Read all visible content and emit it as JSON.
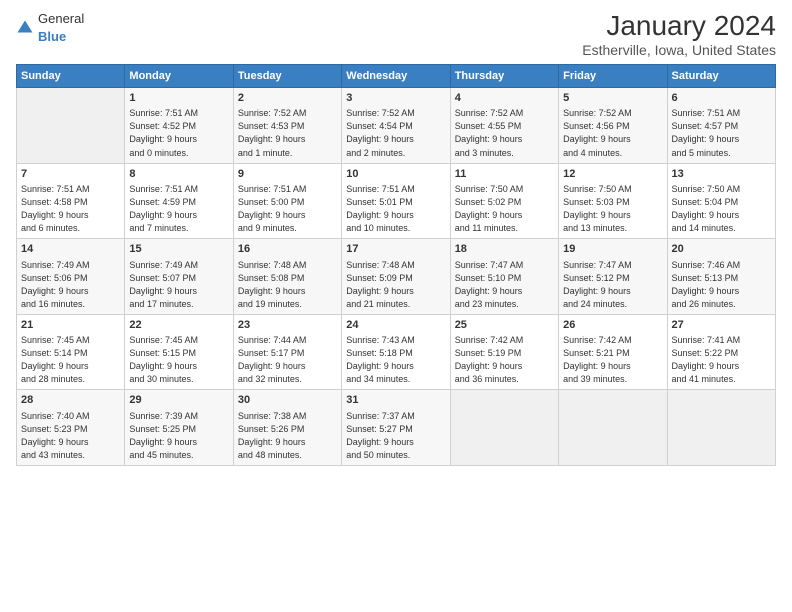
{
  "logo": {
    "general": "General",
    "blue": "Blue"
  },
  "title": "January 2024",
  "subtitle": "Estherville, Iowa, United States",
  "columns": [
    "Sunday",
    "Monday",
    "Tuesday",
    "Wednesday",
    "Thursday",
    "Friday",
    "Saturday"
  ],
  "weeks": [
    [
      {
        "day": "",
        "content": ""
      },
      {
        "day": "1",
        "content": "Sunrise: 7:51 AM\nSunset: 4:52 PM\nDaylight: 9 hours\nand 0 minutes."
      },
      {
        "day": "2",
        "content": "Sunrise: 7:52 AM\nSunset: 4:53 PM\nDaylight: 9 hours\nand 1 minute."
      },
      {
        "day": "3",
        "content": "Sunrise: 7:52 AM\nSunset: 4:54 PM\nDaylight: 9 hours\nand 2 minutes."
      },
      {
        "day": "4",
        "content": "Sunrise: 7:52 AM\nSunset: 4:55 PM\nDaylight: 9 hours\nand 3 minutes."
      },
      {
        "day": "5",
        "content": "Sunrise: 7:52 AM\nSunset: 4:56 PM\nDaylight: 9 hours\nand 4 minutes."
      },
      {
        "day": "6",
        "content": "Sunrise: 7:51 AM\nSunset: 4:57 PM\nDaylight: 9 hours\nand 5 minutes."
      }
    ],
    [
      {
        "day": "7",
        "content": "Sunrise: 7:51 AM\nSunset: 4:58 PM\nDaylight: 9 hours\nand 6 minutes."
      },
      {
        "day": "8",
        "content": "Sunrise: 7:51 AM\nSunset: 4:59 PM\nDaylight: 9 hours\nand 7 minutes."
      },
      {
        "day": "9",
        "content": "Sunrise: 7:51 AM\nSunset: 5:00 PM\nDaylight: 9 hours\nand 9 minutes."
      },
      {
        "day": "10",
        "content": "Sunrise: 7:51 AM\nSunset: 5:01 PM\nDaylight: 9 hours\nand 10 minutes."
      },
      {
        "day": "11",
        "content": "Sunrise: 7:50 AM\nSunset: 5:02 PM\nDaylight: 9 hours\nand 11 minutes."
      },
      {
        "day": "12",
        "content": "Sunrise: 7:50 AM\nSunset: 5:03 PM\nDaylight: 9 hours\nand 13 minutes."
      },
      {
        "day": "13",
        "content": "Sunrise: 7:50 AM\nSunset: 5:04 PM\nDaylight: 9 hours\nand 14 minutes."
      }
    ],
    [
      {
        "day": "14",
        "content": "Sunrise: 7:49 AM\nSunset: 5:06 PM\nDaylight: 9 hours\nand 16 minutes."
      },
      {
        "day": "15",
        "content": "Sunrise: 7:49 AM\nSunset: 5:07 PM\nDaylight: 9 hours\nand 17 minutes."
      },
      {
        "day": "16",
        "content": "Sunrise: 7:48 AM\nSunset: 5:08 PM\nDaylight: 9 hours\nand 19 minutes."
      },
      {
        "day": "17",
        "content": "Sunrise: 7:48 AM\nSunset: 5:09 PM\nDaylight: 9 hours\nand 21 minutes."
      },
      {
        "day": "18",
        "content": "Sunrise: 7:47 AM\nSunset: 5:10 PM\nDaylight: 9 hours\nand 23 minutes."
      },
      {
        "day": "19",
        "content": "Sunrise: 7:47 AM\nSunset: 5:12 PM\nDaylight: 9 hours\nand 24 minutes."
      },
      {
        "day": "20",
        "content": "Sunrise: 7:46 AM\nSunset: 5:13 PM\nDaylight: 9 hours\nand 26 minutes."
      }
    ],
    [
      {
        "day": "21",
        "content": "Sunrise: 7:45 AM\nSunset: 5:14 PM\nDaylight: 9 hours\nand 28 minutes."
      },
      {
        "day": "22",
        "content": "Sunrise: 7:45 AM\nSunset: 5:15 PM\nDaylight: 9 hours\nand 30 minutes."
      },
      {
        "day": "23",
        "content": "Sunrise: 7:44 AM\nSunset: 5:17 PM\nDaylight: 9 hours\nand 32 minutes."
      },
      {
        "day": "24",
        "content": "Sunrise: 7:43 AM\nSunset: 5:18 PM\nDaylight: 9 hours\nand 34 minutes."
      },
      {
        "day": "25",
        "content": "Sunrise: 7:42 AM\nSunset: 5:19 PM\nDaylight: 9 hours\nand 36 minutes."
      },
      {
        "day": "26",
        "content": "Sunrise: 7:42 AM\nSunset: 5:21 PM\nDaylight: 9 hours\nand 39 minutes."
      },
      {
        "day": "27",
        "content": "Sunrise: 7:41 AM\nSunset: 5:22 PM\nDaylight: 9 hours\nand 41 minutes."
      }
    ],
    [
      {
        "day": "28",
        "content": "Sunrise: 7:40 AM\nSunset: 5:23 PM\nDaylight: 9 hours\nand 43 minutes."
      },
      {
        "day": "29",
        "content": "Sunrise: 7:39 AM\nSunset: 5:25 PM\nDaylight: 9 hours\nand 45 minutes."
      },
      {
        "day": "30",
        "content": "Sunrise: 7:38 AM\nSunset: 5:26 PM\nDaylight: 9 hours\nand 48 minutes."
      },
      {
        "day": "31",
        "content": "Sunrise: 7:37 AM\nSunset: 5:27 PM\nDaylight: 9 hours\nand 50 minutes."
      },
      {
        "day": "",
        "content": ""
      },
      {
        "day": "",
        "content": ""
      },
      {
        "day": "",
        "content": ""
      }
    ]
  ]
}
